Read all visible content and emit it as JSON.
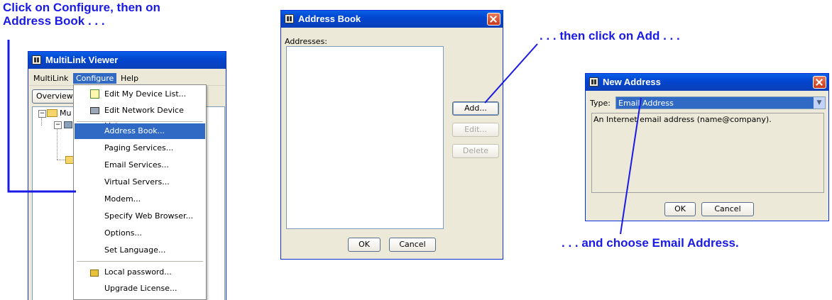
{
  "annotations": {
    "step1_line1": "Click on Configure, then on",
    "step1_line2": "Address Book . . .",
    "step2": ". . . then click on Add . . .",
    "step3": ". . . and choose Email Address."
  },
  "multilink": {
    "title": "MultiLink Viewer",
    "menu": [
      "MultiLink",
      "Configure",
      "Help"
    ],
    "toolbar_tab": "Overview",
    "tree_node": "Mu",
    "configure_menu": {
      "items": [
        {
          "label": "Edit My Device List...",
          "icon": "device-list-icon"
        },
        {
          "label": "Edit Network Device List...",
          "icon": "network-device-icon"
        },
        {
          "label": "Address Book...",
          "highlighted": true
        },
        {
          "label": "Paging Services..."
        },
        {
          "label": "Email Services..."
        },
        {
          "label": "Virtual Servers..."
        },
        {
          "label": "Modem..."
        },
        {
          "label": "Specify Web Browser..."
        },
        {
          "label": "Options..."
        },
        {
          "label": "Set Language..."
        },
        {
          "label": "Local password...",
          "icon": "lock-icon"
        },
        {
          "label": "Upgrade License..."
        }
      ]
    }
  },
  "address_book": {
    "title": "Address Book",
    "addresses_label": "Addresses:",
    "add": "Add...",
    "edit": "Edit...",
    "delete": "Delete",
    "ok": "OK",
    "cancel": "Cancel"
  },
  "new_address": {
    "title": "New Address",
    "type_label": "Type:",
    "type_value": "Email Address",
    "description": "An Internet email address (name@company).",
    "ok": "OK",
    "cancel": "Cancel"
  },
  "colors": {
    "annotation": "#1a1ae6",
    "highlight": "#316ac5",
    "titlebar": "#0246d0"
  }
}
